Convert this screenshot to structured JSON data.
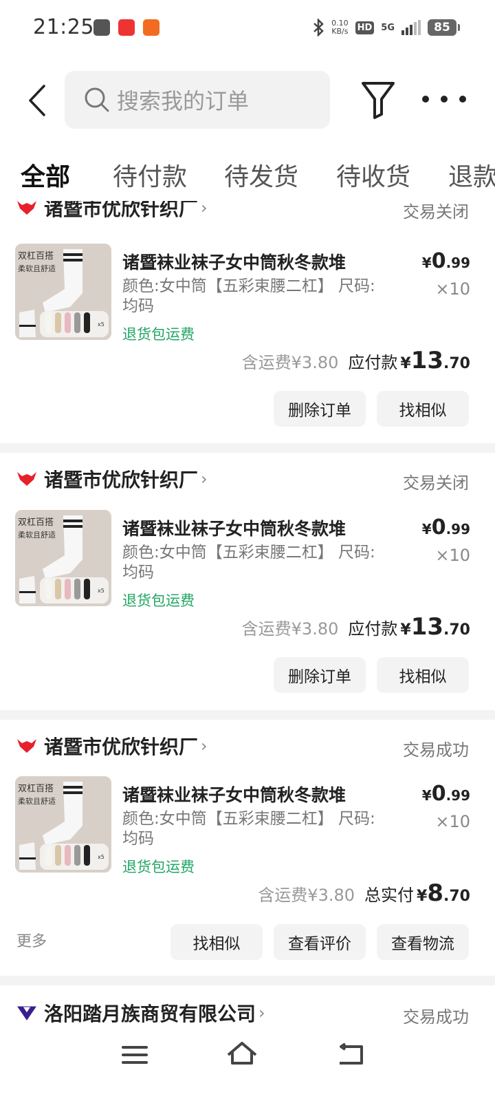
{
  "status_bar": {
    "time": "21:25",
    "net_speed_value": "0.10",
    "net_speed_unit": "KB/s",
    "hd": "HD",
    "network": "5G",
    "battery": "85"
  },
  "header": {
    "search_placeholder": "搜索我的订单"
  },
  "tabs": [
    "全部",
    "待付款",
    "待发货",
    "待收货",
    "退款"
  ],
  "active_tab": 0,
  "orders": [
    {
      "shop": "诸暨市优欣针织厂",
      "status": "交易关闭",
      "title": "诸暨袜业袜子女中筒秋冬款堆",
      "spec": "颜色:女中筒【五彩束腰二杠】 尺码:均码",
      "badge": "退货包运费",
      "price_currency": "¥",
      "price_int": "0",
      "price_dec": ".99",
      "qty": "×10",
      "shipping": "含运费¥3.80",
      "pay_label": "应付款",
      "total_currency": "¥",
      "total_int": "13",
      "total_dec": ".70",
      "buttons": [
        "删除订单",
        "找相似"
      ]
    },
    {
      "shop": "诸暨市优欣针织厂",
      "status": "交易关闭",
      "title": "诸暨袜业袜子女中筒秋冬款堆",
      "spec": "颜色:女中筒【五彩束腰二杠】 尺码:均码",
      "badge": "退货包运费",
      "price_currency": "¥",
      "price_int": "0",
      "price_dec": ".99",
      "qty": "×10",
      "shipping": "含运费¥3.80",
      "pay_label": "应付款",
      "total_currency": "¥",
      "total_int": "13",
      "total_dec": ".70",
      "buttons": [
        "删除订单",
        "找相似"
      ]
    },
    {
      "shop": "诸暨市优欣针织厂",
      "status": "交易成功",
      "title": "诸暨袜业袜子女中筒秋冬款堆",
      "spec": "颜色:女中筒【五彩束腰二杠】 尺码:均码",
      "badge": "退货包运费",
      "price_currency": "¥",
      "price_int": "0",
      "price_dec": ".99",
      "qty": "×10",
      "shipping": "含运费¥3.80",
      "pay_label": "总实付",
      "total_currency": "¥",
      "total_int": "8",
      "total_dec": ".70",
      "more": "更多",
      "buttons": [
        "找相似",
        "查看评价",
        "查看物流"
      ]
    },
    {
      "shop": "洛阳踏月族商贸有限公司",
      "status": "交易成功"
    }
  ],
  "thumb_text": {
    "line1": "双杠百搭",
    "line2": "柔软且舒适",
    "count": "x5"
  },
  "colors": {
    "badge_green": "#22a564",
    "shop_logo_red": "#e8202a",
    "shop_logo_purple": "#3a1f8c",
    "divider": "#f3f3f3"
  }
}
